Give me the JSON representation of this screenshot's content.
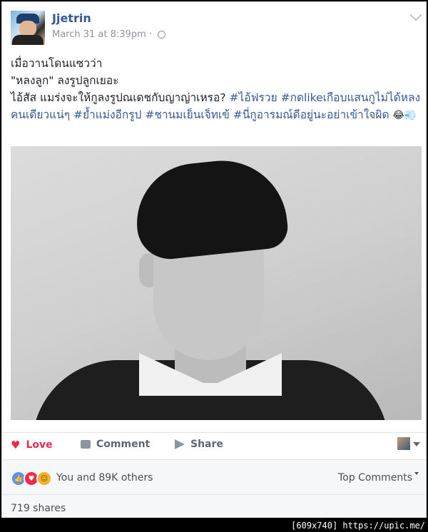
{
  "post": {
    "author": "Jjetrin",
    "date": "March 31 at 8:39pm",
    "separator": "·",
    "lines": {
      "line1": "เมื่อวานโดนแซวว่า",
      "line2": "\"หลงลูก\" ลงรูปลูกเยอะ",
      "line3_text": "ไอ้สัส แมร่งจะให้กูลงรูปณเดชกับญาญ่าเหรอ? ",
      "tag1": "#ไอ้ฟรวย",
      "tag2": "#กดlikeเกือบแสนกูไม่ได้หลงคนเดียวแน่ๆ",
      "tag3": "#ย้ำแม่งอีกรูป",
      "tag4": "#ชานมเย็นเจ็ทเข้",
      "tag5": "#นี่กูอารมณ์ดีอยู่นะอย่าเข้าใจผิด",
      "emoji": "😂💨"
    }
  },
  "actions": {
    "love": "Love",
    "comment": "Comment",
    "share": "Share"
  },
  "reactions": {
    "summary": "You and 89K others",
    "top_comments": "Top Comments"
  },
  "shares": "719 shares",
  "watermark": "[609x740] https://upic.me/",
  "colors": {
    "link": "#365899",
    "love": "#f0284a",
    "like": "#5890ff",
    "haha": "#f7b125"
  },
  "icons": [
    "globe-icon",
    "chevron-down-icon",
    "heart-icon",
    "comment-icon",
    "share-icon",
    "like-reaction-icon",
    "love-reaction-icon",
    "haha-reaction-icon"
  ]
}
